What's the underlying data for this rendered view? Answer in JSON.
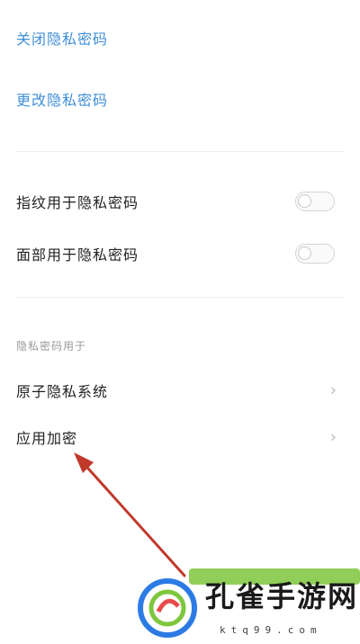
{
  "actions": {
    "close": "关闭隐私密码",
    "change": "更改隐私密码"
  },
  "toggles": [
    {
      "label": "指纹用于隐私密码",
      "on": false
    },
    {
      "label": "面部用于隐私密码",
      "on": false
    }
  ],
  "section": {
    "title": "隐私密码用于",
    "items": [
      {
        "label": "原子隐私系统"
      },
      {
        "label": "应用加密"
      }
    ]
  },
  "watermark": {
    "text": "孔雀手游网",
    "url": "ktq99.com"
  },
  "colors": {
    "link": "#3f8fd9",
    "annotation": "#c0392b",
    "watermark_green": "#7ec63c"
  }
}
